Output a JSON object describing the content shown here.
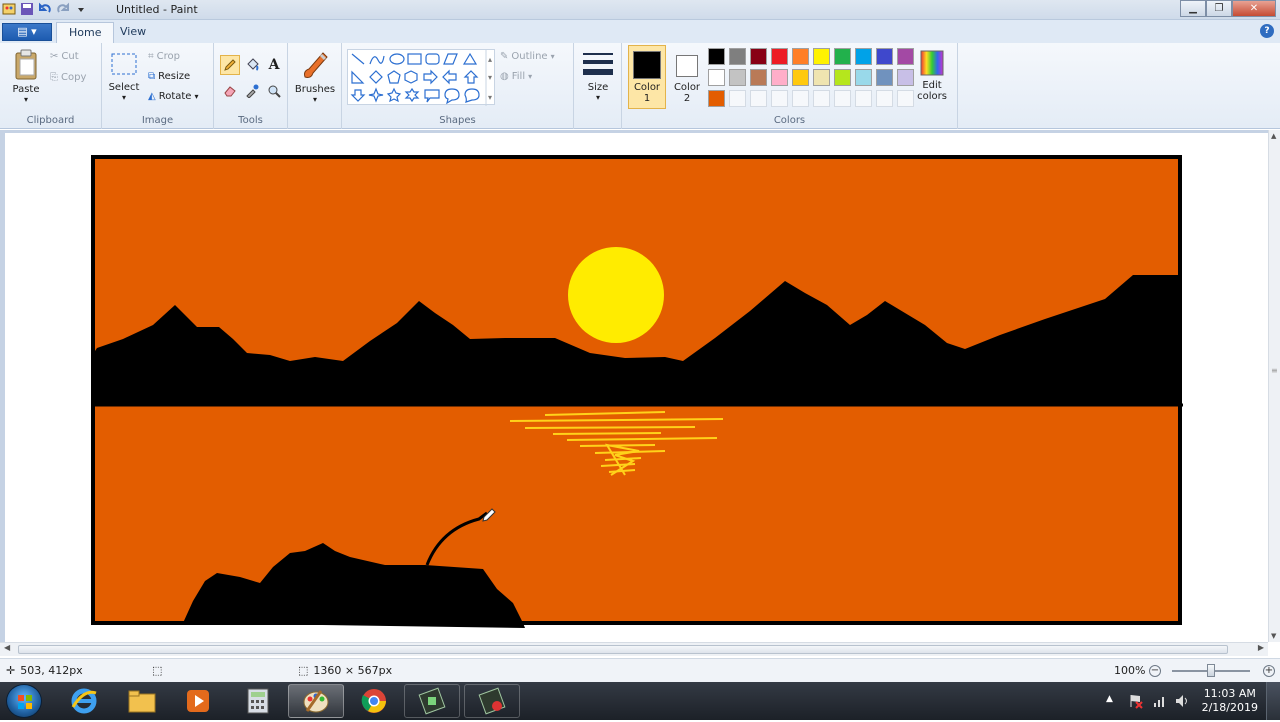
{
  "window": {
    "title": "Untitled - Paint",
    "buttons": {
      "minimize": "▁",
      "maximize": "❐",
      "close": "✕"
    }
  },
  "ribbon_tabs": {
    "file": "▤ ▾",
    "home": "Home",
    "view": "View",
    "help": "?"
  },
  "clipboard": {
    "paste": "Paste",
    "cut": "Cut",
    "copy": "Copy",
    "label": "Clipboard"
  },
  "image": {
    "select": "Select",
    "crop": "Crop",
    "resize": "Resize",
    "rotate": "Rotate",
    "label": "Image"
  },
  "tools": {
    "label": "Tools",
    "text_glyph": "A",
    "selected_tool": "pencil"
  },
  "brushes": {
    "label": "Brushes"
  },
  "shapes": {
    "label": "Shapes",
    "outline": "Outline",
    "fill": "Fill"
  },
  "size": {
    "label": "Size"
  },
  "colors": {
    "color1_label": "Color",
    "color1_num": "1",
    "color2_label": "Color",
    "color2_num": "2",
    "edit_colors_1": "Edit",
    "edit_colors_2": "colors",
    "label": "Colors",
    "color1": "#000000",
    "color2": "#ffffff",
    "palette_row1": [
      "#000000",
      "#7f7f7f",
      "#880015",
      "#ed1c24",
      "#ff7f27",
      "#fff200",
      "#22b14c",
      "#00a2e8",
      "#3f48cc",
      "#a349a4"
    ],
    "palette_row2": [
      "#ffffff",
      "#c3c3c3",
      "#b97a57",
      "#ffaec9",
      "#ffc90e",
      "#efe4b0",
      "#b5e61d",
      "#99d9ea",
      "#7092be",
      "#c8bfe7"
    ],
    "palette_row3": [
      "#e35d00",
      "",
      "",
      "",
      "",
      "",
      "",
      "",
      "",
      ""
    ]
  },
  "drawing": {
    "sky_color": "#e35d00",
    "sun_color": "#ffec00",
    "silhouette_color": "#000000"
  },
  "status": {
    "cursor_pos": "503, 412px",
    "canvas_size": "1360 × 567px",
    "zoom": "100%",
    "zoom_minus": "−",
    "zoom_plus": "+"
  },
  "taskbar": {
    "apps": [
      "internet-explorer",
      "file-explorer",
      "media-player",
      "calculator",
      "paint",
      "chrome",
      "app-1",
      "app-2"
    ],
    "time": "11:03 AM",
    "date": "2/18/2019"
  }
}
